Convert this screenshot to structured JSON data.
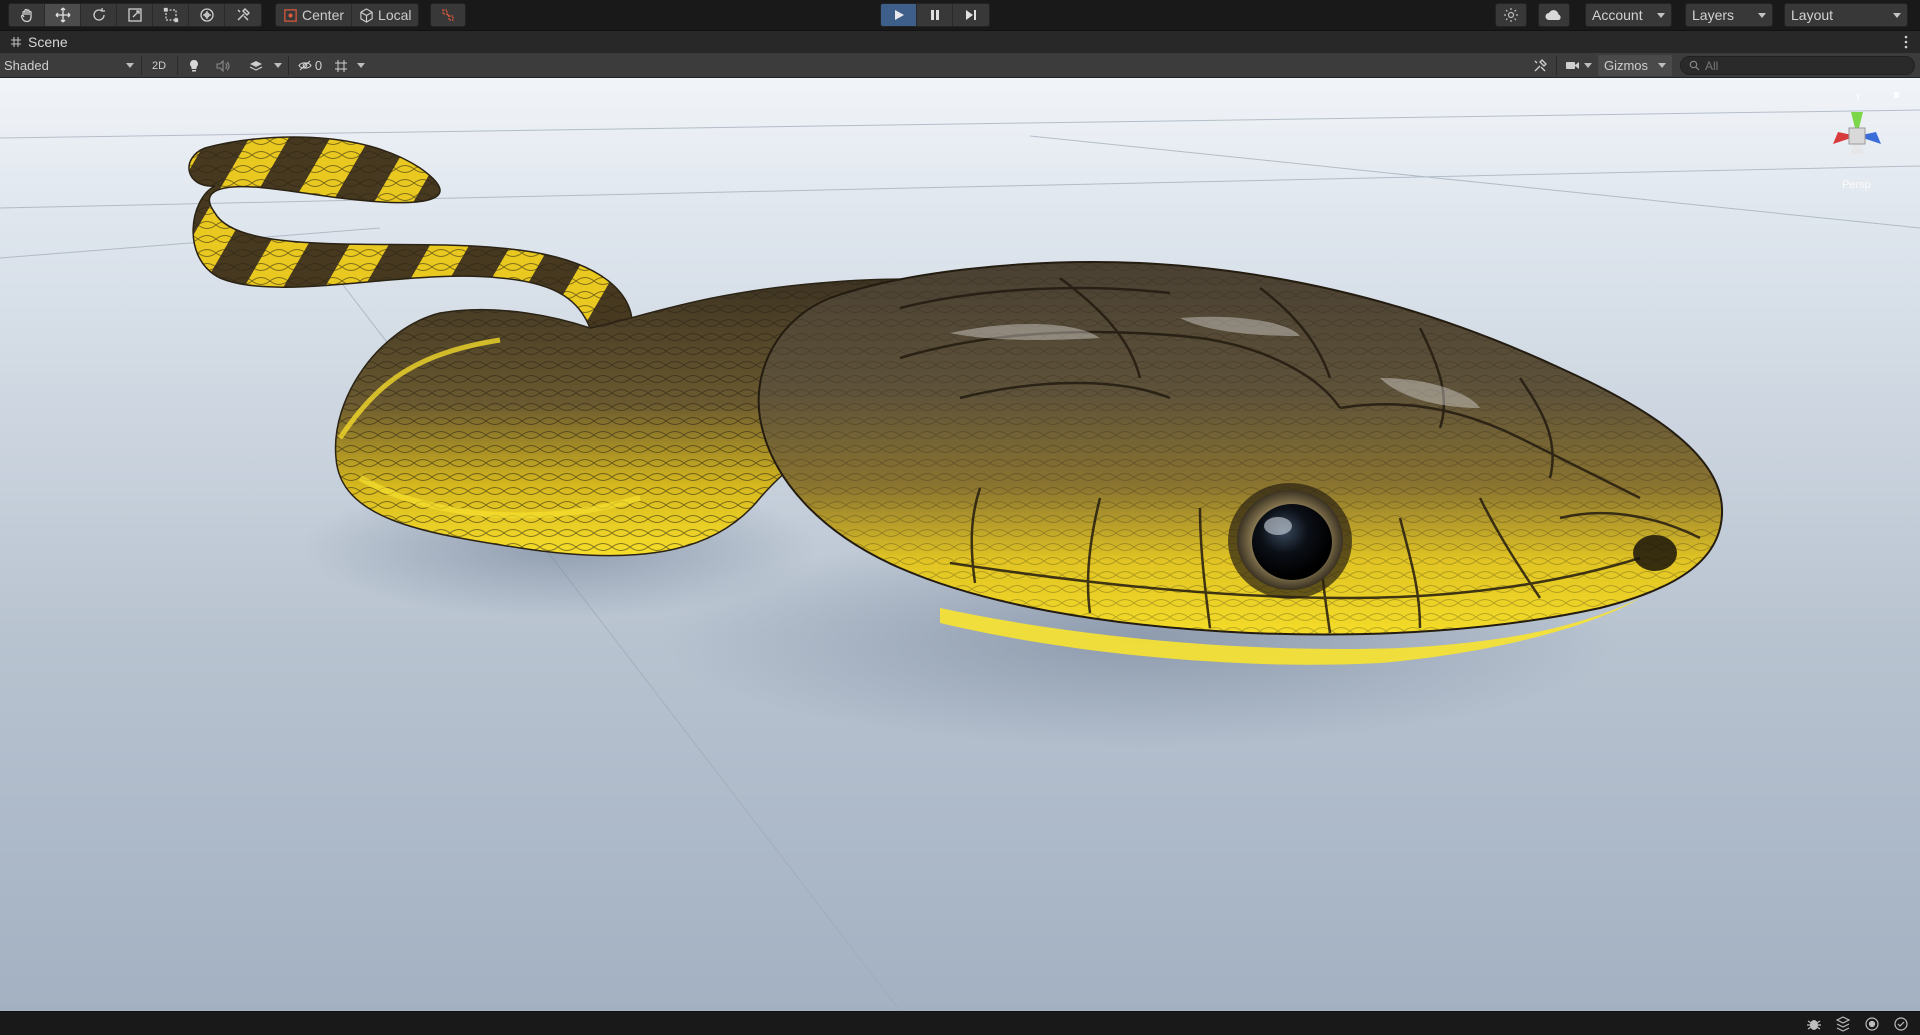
{
  "tools": [
    {
      "name": "hand-tool",
      "icon": "hand-icon"
    },
    {
      "name": "move-tool",
      "icon": "move-icon",
      "active": true
    },
    {
      "name": "rotate-tool",
      "icon": "rotate-icon"
    },
    {
      "name": "scale-tool",
      "icon": "scale-icon"
    },
    {
      "name": "rect-tool",
      "icon": "rect-icon"
    },
    {
      "name": "transform-tool",
      "icon": "transform-icon"
    },
    {
      "name": "custom-tool",
      "icon": "tools-icon"
    }
  ],
  "pivot": {
    "center_label": "Center",
    "local_label": "Local"
  },
  "header": {
    "account_label": "Account",
    "layers_label": "Layers",
    "layout_label": "Layout"
  },
  "scene_tab": {
    "label": "Scene"
  },
  "scene_toolbar": {
    "draw_mode": "Shaded",
    "toggle_2d": "2D",
    "hidden_count": "0",
    "gizmos_label": "Gizmos",
    "search_placeholder": "All"
  },
  "gizmo": {
    "projection_label": "Persp",
    "y_label": "y"
  },
  "colors": {
    "accent_play": "#3d5f8a",
    "snake_yellow": "#f0d21c",
    "snake_dark": "#4b3e22",
    "sky_top": "#eaf0f7",
    "ground": "#a9b6c6"
  }
}
